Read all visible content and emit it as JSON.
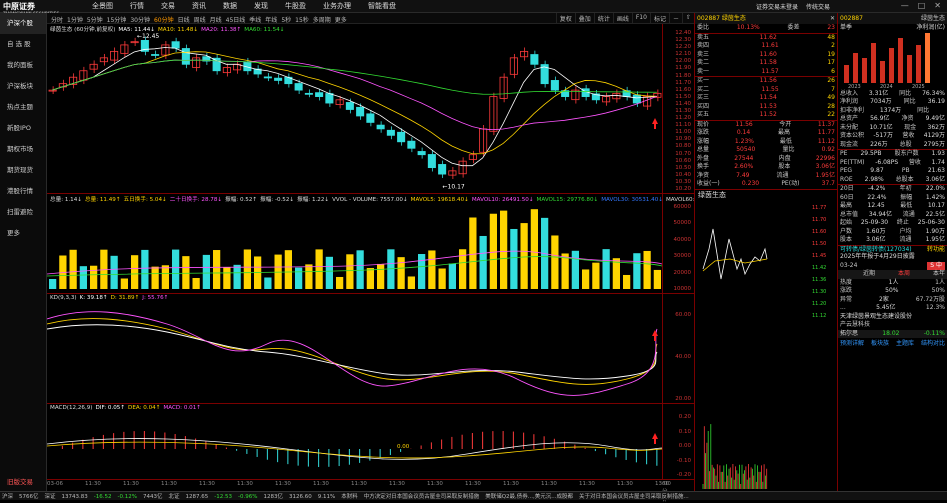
{
  "app": {
    "name": "中原证券",
    "subtitle": "ZHONGYUAN SECURITIES"
  },
  "mainmenu": [
    "全景图",
    "行情",
    "交易",
    "资讯",
    "数据",
    "发现",
    "牛股盈",
    "业务办理",
    "智能看盘"
  ],
  "topright": [
    "证券交易未登录",
    "传统交易"
  ],
  "sidebar": [
    "沪深个股",
    "自 选 股",
    "我的面板",
    "沪深板块",
    "热点主题",
    "新股IPO",
    "期权市场",
    "期货现货",
    "港股行情",
    "扫雷避险",
    "更多",
    "旧版交易"
  ],
  "period_tabs": [
    "分时",
    "1分钟",
    "5分钟",
    "15分钟",
    "30分钟",
    "60分钟",
    "日线",
    "周线",
    "月线",
    "45日线",
    "季线",
    "年线",
    "5秒",
    "15秒",
    "多周期",
    "更多"
  ],
  "toolbar_right": [
    "复权",
    "叠加",
    "统计",
    "画线",
    "F10",
    "标记",
    "－",
    "⇧"
  ],
  "k_legend": [
    "绿茵生态 (60分钟,前复权)",
    "MA5: 11.44↓",
    "MA10: 11.48↓",
    "MA20: 11.38↑",
    "MA60: 11.54↓"
  ],
  "k_axis": [
    "12.40",
    "12.30",
    "12.20",
    "12.10",
    "12.00",
    "11.90",
    "11.80",
    "11.70",
    "11.60",
    "11.50",
    "11.40",
    "11.30",
    "11.20",
    "11.10",
    "11.00",
    "10.90",
    "10.80",
    "10.70",
    "10.60",
    "10.50",
    "10.40",
    "10.30",
    "10.20"
  ],
  "k_marks": {
    "high": "12.45",
    "low": "10.17"
  },
  "vol_legend": [
    "总量: 1.14↓",
    "总量: 11.49↑",
    "五日换手: 5.04↓",
    "二十日换手: 28.78↓",
    "振幅: 0.52↑",
    "振幅: -0.52↓",
    "振幅: 1.22↓",
    "VVOL - VOLUME: 7557.00↓",
    "MAVOL5: 19618.40↓",
    "MAVOL10: 26491.50↓",
    "MAVOL15: 29776.80↓",
    "MAVOL30: 30531.40↓",
    "MAVOL60: 18016.00↓"
  ],
  "vol_axis": [
    "60000",
    "50000",
    "40000",
    "30000",
    "20000",
    "10000"
  ],
  "kd_legend": [
    "KD(9,3,3)",
    "K: 39.18↑",
    "D: 31.89↑",
    "J: 55.76↑"
  ],
  "kd_axis": [
    "60.00",
    "40.00",
    "20.00"
  ],
  "macd_legend": [
    "MACD(12,26,9)",
    "DIF: 0.05↑",
    "DEA: 0.04↑",
    "MACD: 0.01↑"
  ],
  "macd_axis": [
    "0.20",
    "0.10",
    "0.00",
    "-0.10",
    "-0.20"
  ],
  "macd_mark": "0.00",
  "x_labels": [
    "03-06",
    "11:30",
    "11:30",
    "11:30",
    "11:30",
    "11:30",
    "11:30",
    "11:30",
    "11:30",
    "11:30",
    "11:30",
    "11:30",
    "11:30",
    "11:30",
    "11:30",
    "11:30",
    "13:00"
  ],
  "x_end": "60分钟",
  "bottom_tabs": [
    "指标A",
    "筹码 B",
    "超 C",
    "能量 D",
    "超越 E",
    "KD",
    "MA",
    "MA2",
    "MA3",
    "KDJ",
    "MACD",
    "DMI",
    "DMA",
    "FSL",
    "TRIX",
    "BRAR",
    "CR",
    "VR",
    "OBV",
    "ASI",
    "VOL-TDX",
    "RSI",
    "WR",
    "SAR",
    "CCI",
    "ROC",
    "MTM",
    "BOLL",
    "PSY",
    "MCST",
    "龙线",
    "捕捞",
    "黄"
  ],
  "bottom_sub": [
    "关联报价",
    "交易查询",
    "资金流向",
    "财务报表",
    "综合资讯",
    "短线精灵",
    "自选股"
  ],
  "quote": {
    "code": "002887",
    "name": "绿茵生态",
    "weibi_label": "委比",
    "weibi": "10.13%",
    "weicha_label": "委差",
    "weicha": "23",
    "sells": [
      [
        "卖五",
        "11.62",
        "48"
      ],
      [
        "卖四",
        "11.61",
        "2"
      ],
      [
        "卖三",
        "11.60",
        "19"
      ],
      [
        "卖二",
        "11.58",
        "17"
      ],
      [
        "卖一",
        "11.57",
        "6"
      ]
    ],
    "buys": [
      [
        "买一",
        "11.56",
        "26"
      ],
      [
        "买二",
        "11.55",
        "7"
      ],
      [
        "买三",
        "11.54",
        "49"
      ],
      [
        "买四",
        "11.53",
        "28"
      ],
      [
        "买五",
        "11.52",
        "22"
      ]
    ],
    "stats": [
      [
        "现价",
        "11.56",
        "今开",
        "11.37"
      ],
      [
        "涨跌",
        "0.14",
        "最高",
        "11.77"
      ],
      [
        "涨幅",
        "1.23%",
        "最低",
        "11.12"
      ],
      [
        "总量",
        "50540",
        "量比",
        "0.92"
      ],
      [
        "外盘",
        "27544",
        "内盘",
        "22996"
      ],
      [
        "换手",
        "2.60%",
        "股本",
        "3.06亿"
      ],
      [
        "净资",
        "7.49",
        "流通",
        "1.95亿"
      ],
      [
        "收益(一)",
        "0.230",
        "PE(动)",
        "37.7"
      ]
    ]
  },
  "mini_chart": {
    "title": "绿茵生态",
    "axis": [
      "11.77",
      "11.70",
      "11.60",
      "11.50",
      "11.45",
      "11.42",
      "11.36",
      "11.30",
      "11.20",
      "11.12"
    ]
  },
  "f10": {
    "code": "002887",
    "name": "绿茵生态",
    "tabs": [
      "单季",
      "净利润(亿)"
    ],
    "bars_label": [
      "2023",
      "2024",
      "2025"
    ],
    "rows": [
      [
        "总收入",
        "3.31亿",
        "同比",
        "76.34%"
      ],
      [
        "净利润",
        "7034万",
        "同比",
        "36.19"
      ],
      [
        "扣非净利",
        "1374万",
        "同比",
        ""
      ],
      [
        "总资产",
        "56.9亿",
        "净资",
        "9.49亿"
      ],
      [
        "未分配",
        "10.71亿",
        "现金",
        "362万"
      ],
      [
        "资本公积",
        "-517万",
        "营收",
        "4129万"
      ],
      [
        "现金流",
        "226万",
        "总股",
        "2795万"
      ]
    ],
    "rows2": [
      [
        "PE",
        "29.5PB",
        "股东户数",
        "1.93"
      ],
      [
        "PE(TTM)",
        "-6.08PS",
        "营收",
        "1.74"
      ],
      [
        "PEG",
        "9.87",
        "PB",
        "21.63"
      ],
      [
        "ROE",
        "2.98%",
        "总股本",
        "3.06亿"
      ]
    ],
    "rows3": [
      [
        "20日",
        "-4.2%",
        "年初",
        "22.0%"
      ],
      [
        "60日",
        "22.4%",
        "振幅",
        "1.42%"
      ],
      [
        "最高",
        "12.45",
        "最低",
        "10.17"
      ],
      [
        "总市值",
        "34.94亿",
        "流通",
        "22.5亿"
      ],
      [
        "起始",
        "25-09-30",
        "终止",
        "25-06-30"
      ],
      [
        "户数",
        "1.60万",
        "户均",
        "1.90万"
      ],
      [
        "股本",
        "3.06亿",
        "流通",
        "1.95亿"
      ]
    ],
    "notice_label": "可转债/绿茵转债(127034)",
    "notice_link": "转功能",
    "report": "2025年年报于4月29日披露",
    "time": "03-24",
    "hot_tabs": [
      "近期",
      "本周",
      "本年"
    ],
    "hot_rows": [
      [
        "热度",
        "1人",
        "1人"
      ],
      [
        "涨跌",
        "50%",
        "50%"
      ],
      [
        "异常",
        "2家",
        "67.72万股"
      ],
      [
        "...",
        "5.45亿",
        "12.3%"
      ]
    ],
    "company": "天津绿茵景观生态建设股份",
    "pe_label": "产云慧科技",
    "peer": {
      "name": "拓尔思",
      "price": "18.02",
      "chg": "-0.11%"
    },
    "buttons": [
      "预测详解",
      "板块族",
      "主题库",
      "结构对比"
    ]
  },
  "status": [
    "沪深",
    "5766亿",
    "深证",
    "13743.83",
    "-16.52",
    "-0.12%",
    "7443亿",
    "北证",
    "1287.65",
    "-12.53",
    "-0.96%",
    "1283亿",
    "3126.60",
    "9.11%",
    "本财料",
    "中方决定对日本国会议员古屋圭司采取反制措施",
    "美联储Q2最,债券...,美元沉...成股都",
    "关于对日本国会议员古屋圭司采取反制措施..."
  ]
}
